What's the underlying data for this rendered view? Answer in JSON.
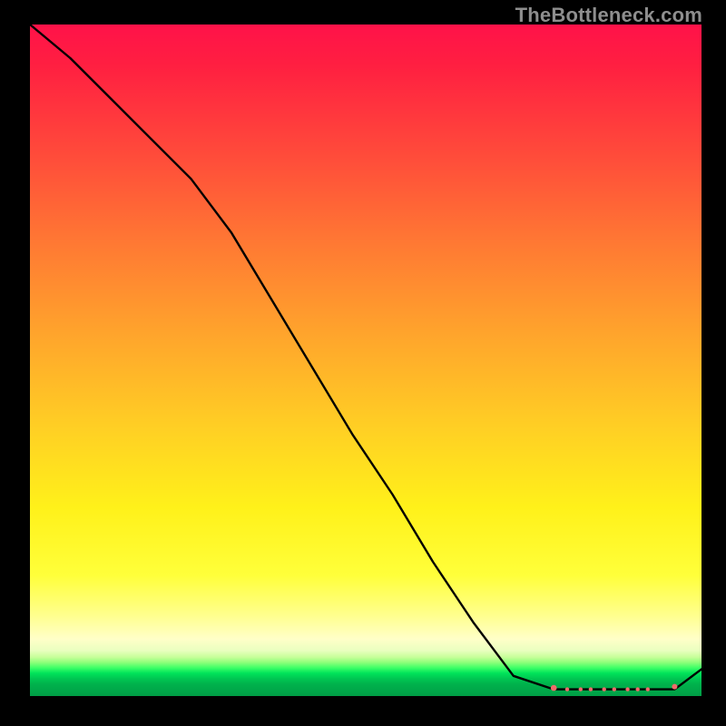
{
  "watermark": "TheBottleneck.com",
  "chart_data": {
    "type": "line",
    "title": "",
    "xlabel": "",
    "ylabel": "",
    "xlim": [
      0,
      100
    ],
    "ylim": [
      0,
      100
    ],
    "background": "heat-gradient-red-to-green-vertical",
    "series": [
      {
        "name": "bottleneck-curve",
        "color": "#000000",
        "x": [
          0,
          6,
          12,
          18,
          24,
          30,
          36,
          42,
          48,
          54,
          60,
          66,
          72,
          78,
          84,
          90,
          96,
          100
        ],
        "y": [
          100,
          95,
          89,
          83,
          77,
          69,
          59,
          49,
          39,
          30,
          20,
          11,
          3,
          1,
          1,
          1,
          1,
          4
        ]
      }
    ],
    "markers": {
      "name": "optimal-range",
      "color": "#f26a6a",
      "points": [
        {
          "x": 78,
          "y": 1.2,
          "r": 3.3
        },
        {
          "x": 80,
          "y": 1.0,
          "r": 2.2
        },
        {
          "x": 82,
          "y": 1.0,
          "r": 2.2
        },
        {
          "x": 83.5,
          "y": 1.0,
          "r": 2.2
        },
        {
          "x": 85.5,
          "y": 1.0,
          "r": 2.2
        },
        {
          "x": 87,
          "y": 1.0,
          "r": 2.2
        },
        {
          "x": 89,
          "y": 1.0,
          "r": 2.2
        },
        {
          "x": 90.5,
          "y": 1.0,
          "r": 2.2
        },
        {
          "x": 92,
          "y": 1.0,
          "r": 2.2
        },
        {
          "x": 96,
          "y": 1.4,
          "r": 3.0
        }
      ]
    }
  }
}
